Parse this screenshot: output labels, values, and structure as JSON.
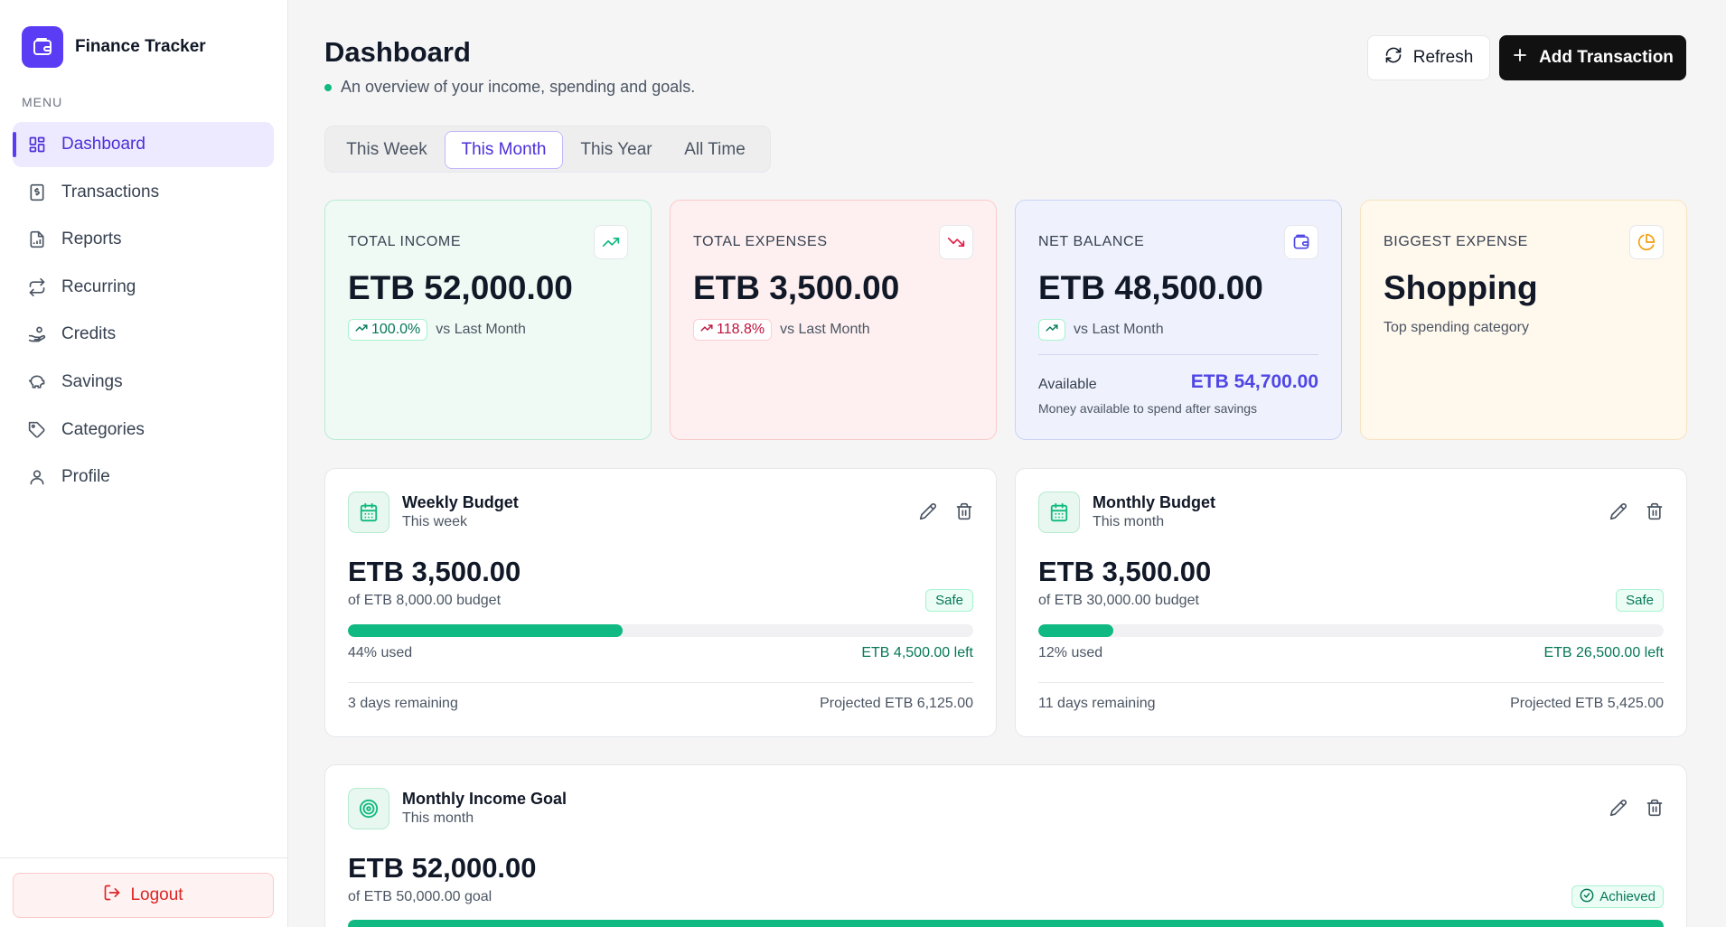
{
  "app": {
    "name": "Finance Tracker"
  },
  "sidebar": {
    "menu_label": "MENU",
    "items": [
      {
        "label": "Dashboard",
        "icon": "grid-icon",
        "active": true
      },
      {
        "label": "Transactions",
        "icon": "receipt-icon"
      },
      {
        "label": "Reports",
        "icon": "report-icon"
      },
      {
        "label": "Recurring",
        "icon": "repeat-icon"
      },
      {
        "label": "Credits",
        "icon": "hand-coins-icon"
      },
      {
        "label": "Savings",
        "icon": "piggy-bank-icon"
      },
      {
        "label": "Categories",
        "icon": "tag-icon"
      },
      {
        "label": "Profile",
        "icon": "user-icon"
      }
    ],
    "logout_label": "Logout"
  },
  "header": {
    "title": "Dashboard",
    "subtitle": "An overview of your income, spending and goals.",
    "refresh_label": "Refresh",
    "add_label": "Add Transaction"
  },
  "periods": {
    "tabs": [
      "This Week",
      "This Month",
      "This Year",
      "All Time"
    ],
    "active": "This Month"
  },
  "stats": {
    "income": {
      "label": "TOTAL INCOME",
      "value": "ETB 52,000.00",
      "delta": "100.0%",
      "compare": "vs Last Month"
    },
    "expenses": {
      "label": "TOTAL EXPENSES",
      "value": "ETB 3,500.00",
      "delta": "118.8%",
      "compare": "vs Last Month"
    },
    "net": {
      "label": "NET BALANCE",
      "value": "ETB 48,500.00",
      "compare": "vs Last Month",
      "available_label": "Available",
      "available_value": "ETB 54,700.00",
      "available_note": "Money available to spend after savings"
    },
    "biggest": {
      "label": "BIGGEST EXPENSE",
      "value": "Shopping",
      "note": "Top spending category"
    }
  },
  "budgets": {
    "weekly": {
      "title": "Weekly Budget",
      "subtitle": "This week",
      "amount": "ETB 3,500.00",
      "of": "of ETB 8,000.00 budget",
      "status": "Safe",
      "progress": 0.44,
      "used": "44% used",
      "left": "ETB 4,500.00 left",
      "remaining": "3 days remaining",
      "projected": "Projected ETB 6,125.00"
    },
    "monthly": {
      "title": "Monthly Budget",
      "subtitle": "This month",
      "amount": "ETB 3,500.00",
      "of": "of ETB 30,000.00 budget",
      "status": "Safe",
      "progress": 0.12,
      "used": "12% used",
      "left": "ETB 26,500.00 left",
      "remaining": "11 days remaining",
      "projected": "Projected ETB 5,425.00"
    }
  },
  "goal": {
    "title": "Monthly Income Goal",
    "subtitle": "This month",
    "amount": "ETB 52,000.00",
    "of": "of ETB 50,000.00 goal",
    "status": "Achieved",
    "progress": 1.0
  },
  "colors": {
    "accent": "#5b3cf5",
    "success": "#10b981",
    "danger": "#dc2626"
  }
}
